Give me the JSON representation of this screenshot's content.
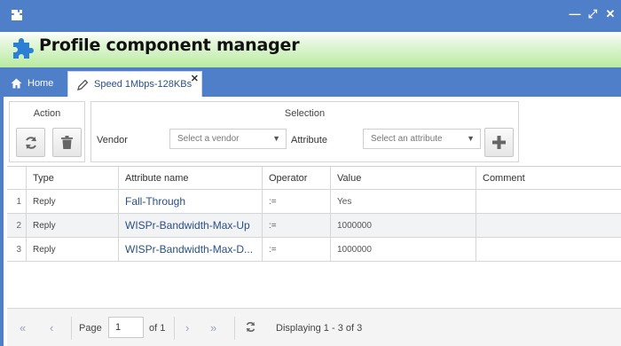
{
  "window": {
    "app_icon": "puzzle-icon",
    "controls": [
      "minimize-icon",
      "restore-icon",
      "close-icon"
    ]
  },
  "header": {
    "title": "Profile component manager",
    "logo": "puzzle-icon"
  },
  "tabs": {
    "home_label": "Home",
    "active_label": "Speed 1Mbps-128KBs"
  },
  "toolbar": {
    "action_title": "Action",
    "selection_title": "Selection",
    "vendor_label": "Vendor",
    "vendor_placeholder": "Select a vendor",
    "attribute_label": "Attribute",
    "attribute_placeholder": "Select an attribute"
  },
  "grid": {
    "columns": [
      "Type",
      "Attribute name",
      "Operator",
      "Value",
      "Comment"
    ],
    "rows": [
      {
        "num": "1",
        "type": "Reply",
        "attribute": "Fall-Through",
        "operator": ":=",
        "value": "Yes",
        "comment": ""
      },
      {
        "num": "2",
        "type": "Reply",
        "attribute": "WISPr-Bandwidth-Max-Up",
        "operator": ":=",
        "value": "1000000",
        "comment": ""
      },
      {
        "num": "3",
        "type": "Reply",
        "attribute": "WISPr-Bandwidth-Max-D...",
        "operator": ":=",
        "value": "1000000",
        "comment": ""
      }
    ]
  },
  "pager": {
    "page_label": "Page",
    "page_value": "1",
    "of_label": "of 1",
    "displaying": "Displaying 1 - 3 of 3"
  },
  "colors": {
    "accent": "#4e7fc8",
    "header_green": "#b8eba0",
    "link": "#2a4f86"
  }
}
